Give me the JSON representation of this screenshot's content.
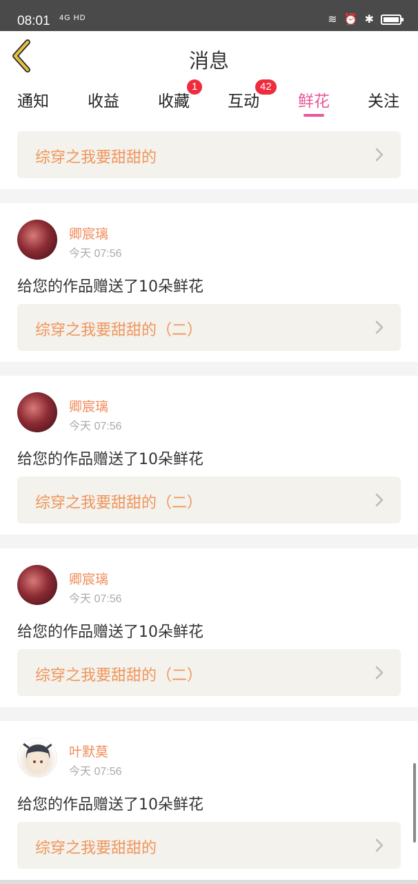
{
  "status_bar": {
    "time": "08:01",
    "signal": "4G HD"
  },
  "header": {
    "title": "消息"
  },
  "tabs": [
    {
      "label": "通知"
    },
    {
      "label": "收益"
    },
    {
      "label": "收藏",
      "badge": "1"
    },
    {
      "label": "互动",
      "badge": "42"
    },
    {
      "label": "鲜花",
      "active": true
    },
    {
      "label": "关注"
    }
  ],
  "messages": [
    {
      "work_title": "综穿之我要甜甜的"
    },
    {
      "user": "卿宸璃",
      "time": "今天 07:56",
      "text": "给您的作品赠送了10朵鲜花",
      "work_title": "综穿之我要甜甜的（二）"
    },
    {
      "user": "卿宸璃",
      "time": "今天 07:56",
      "text": "给您的作品赠送了10朵鲜花",
      "work_title": "综穿之我要甜甜的（二）"
    },
    {
      "user": "卿宸璃",
      "time": "今天 07:56",
      "text": "给您的作品赠送了10朵鲜花",
      "work_title": "综穿之我要甜甜的（二）"
    },
    {
      "user": "叶默莫",
      "time": "今天 07:56",
      "text": "给您的作品赠送了10朵鲜花",
      "work_title": "综穿之我要甜甜的"
    }
  ],
  "colors": {
    "accent": "#e8559a",
    "name": "#f08c5a",
    "work_title": "#f0955d",
    "badge": "#ef2c3d",
    "back_icon": "#e7c23e"
  }
}
